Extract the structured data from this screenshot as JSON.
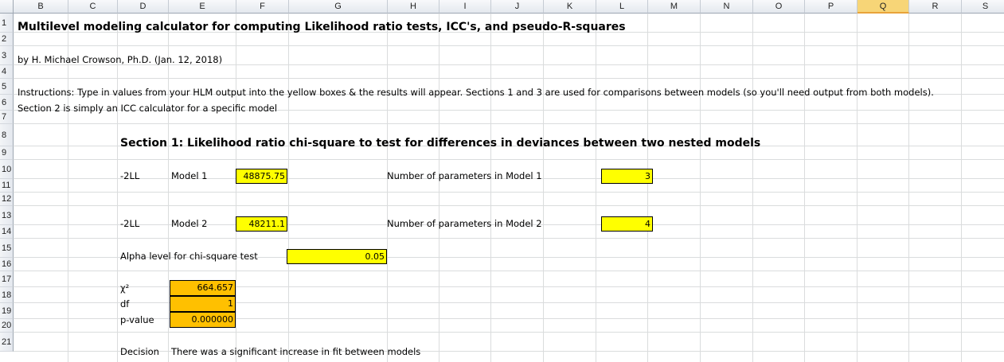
{
  "columns": [
    "B",
    "C",
    "D",
    "E",
    "F",
    "G",
    "H",
    "I",
    "J",
    "K",
    "L",
    "M",
    "N",
    "O",
    "P",
    "Q",
    "R",
    "S"
  ],
  "selected_column": "Q",
  "rows": [
    "1",
    "2",
    "3",
    "4",
    "5",
    "6",
    "7",
    "8",
    "9",
    "10",
    "11",
    "12",
    "13",
    "14",
    "15",
    "16",
    "17",
    "18",
    "19",
    "20",
    "21"
  ],
  "title": "Multilevel modeling calculator for computing Likelihood ratio tests, ICC's, and pseudo-R-squares",
  "author": "by H. Michael Crowson, Ph.D. (Jan. 12, 2018)",
  "instructions_1": "Instructions: Type in values from your HLM output into the yellow boxes & the results will appear. Sections 1 and 3 are used for comparisons between models (so you'll need output from both models).",
  "instructions_2": "Section 2 is simply an ICC calculator for a specific model",
  "section1": {
    "heading": "Section 1: Likelihood ratio chi-square to test for differences in deviances between two nested models",
    "model1": {
      "ll_label": "-2LL",
      "model_label": "Model 1",
      "deviance": "48875.75",
      "params_label": "Number of parameters in Model 1",
      "params": "3"
    },
    "model2": {
      "ll_label": "-2LL",
      "model_label": "Model 2",
      "deviance": "48211.1",
      "params_label": "Number of parameters in Model 2",
      "params": "4"
    },
    "alpha_label": "Alpha level for chi-square test",
    "alpha": "0.05",
    "chi_label": "χ²",
    "chi_value": "664.657",
    "df_label": "df",
    "df_value": "1",
    "p_label": "p-value",
    "p_value": "0.000000",
    "decision_label": "Decision",
    "decision_text": "There was a significant increase in fit between models"
  },
  "colors": {
    "input_yellow": "#ffff00",
    "output_orange": "#ffc000",
    "selected_header": "#f7d577"
  }
}
